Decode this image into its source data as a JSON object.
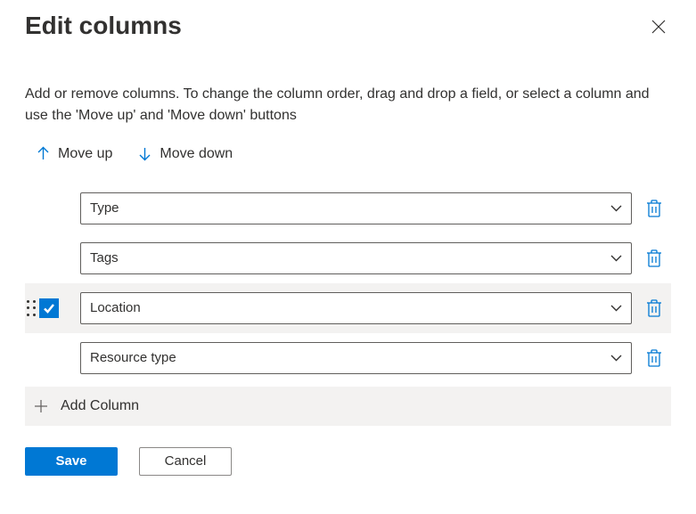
{
  "header": {
    "title": "Edit columns"
  },
  "description": "Add or remove columns. To change the column order, drag and drop a field, or select a column and use the 'Move up' and 'Move down' buttons",
  "toolbar": {
    "move_up_label": "Move up",
    "move_down_label": "Move down"
  },
  "columns": [
    {
      "value": "Type",
      "selected": false
    },
    {
      "value": "Tags",
      "selected": false
    },
    {
      "value": "Location",
      "selected": true
    },
    {
      "value": "Resource type",
      "selected": false
    }
  ],
  "add_column_label": "Add Column",
  "footer": {
    "save_label": "Save",
    "cancel_label": "Cancel"
  },
  "colors": {
    "accent": "#0078d4",
    "text": "#323130",
    "border": "#605e5c",
    "hover_bg": "#f3f2f1"
  }
}
